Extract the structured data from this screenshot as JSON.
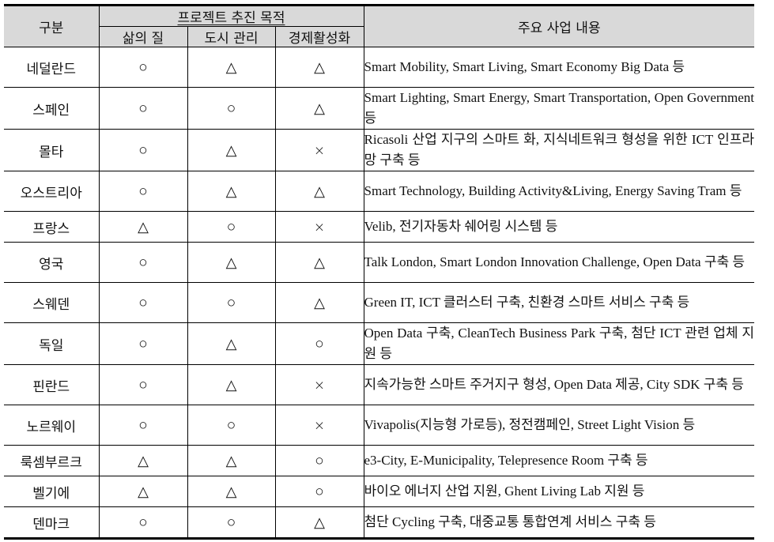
{
  "header": {
    "category": "구분",
    "group_title": "프로젝트 추진 목적",
    "sub_columns": [
      "삶의 질",
      "도시 관리",
      "경제활성화"
    ],
    "content_title": "주요 사업 내용"
  },
  "legend_symbols": {
    "circle": "○",
    "triangle": "△",
    "cross": "×"
  },
  "rows": [
    {
      "country": "네덜란드",
      "quality_of_life": "○",
      "city_management": "△",
      "economic_activation": "△",
      "content": "Smart Mobility, Smart Living, Smart Economy Big Data 등",
      "lines": 2
    },
    {
      "country": "스페인",
      "quality_of_life": "○",
      "city_management": "○",
      "economic_activation": "△",
      "content": "Smart Lighting, Smart Energy, Smart Transportation, Open Government 등",
      "lines": 2
    },
    {
      "country": "몰타",
      "quality_of_life": "○",
      "city_management": "△",
      "economic_activation": "×",
      "content": "Ricasoli 산업 지구의 스마트 화, 지식네트워크 형성을 위한 ICT 인프라 망 구축 등",
      "lines": 2
    },
    {
      "country": "오스트리아",
      "quality_of_life": "○",
      "city_management": "△",
      "economic_activation": "△",
      "content": "Smart Technology, Building Activity&Living, Energy Saving Tram 등",
      "lines": 2
    },
    {
      "country": "프랑스",
      "quality_of_life": "△",
      "city_management": "○",
      "economic_activation": "×",
      "content": "Velib, 전기자동차 쉐어링 시스템 등",
      "lines": 1
    },
    {
      "country": "영국",
      "quality_of_life": "○",
      "city_management": "△",
      "economic_activation": "△",
      "content": "Talk London, Smart London Innovation Challenge, Open Data 구축 등",
      "lines": 2
    },
    {
      "country": "스웨덴",
      "quality_of_life": "○",
      "city_management": "○",
      "economic_activation": "△",
      "content": "Green IT, ICT 클러스터 구축, 친환경 스마트 서비스 구축 등",
      "lines": 2
    },
    {
      "country": "독일",
      "quality_of_life": "○",
      "city_management": "△",
      "economic_activation": "○",
      "content": "Open Data 구축, CleanTech Business Park 구축, 첨단 ICT 관련 업체 지원 등",
      "lines": 2
    },
    {
      "country": "핀란드",
      "quality_of_life": "○",
      "city_management": "△",
      "economic_activation": "×",
      "content": "지속가능한 스마트 주거지구 형성, Open Data 제공, City SDK 구축 등",
      "lines": 2
    },
    {
      "country": "노르웨이",
      "quality_of_life": "○",
      "city_management": "○",
      "economic_activation": "×",
      "content": "Vivapolis(지능형 가로등), 정전캠페인, Street Light Vision 등",
      "lines": 2
    },
    {
      "country": "룩셈부르크",
      "quality_of_life": "△",
      "city_management": "△",
      "economic_activation": "○",
      "content": "e3-City, E-Municipality, Telepresence Room 구축 등",
      "lines": 1
    },
    {
      "country": "벨기에",
      "quality_of_life": "△",
      "city_management": "△",
      "economic_activation": "○",
      "content": "바이오 에너지 산업 지원, Ghent Living Lab 지원 등",
      "lines": 1
    },
    {
      "country": "덴마크",
      "quality_of_life": "○",
      "city_management": "○",
      "economic_activation": "△",
      "content": "첨단 Cycling 구축, 대중교통 통합연계 서비스 구축 등",
      "lines": 1
    }
  ]
}
